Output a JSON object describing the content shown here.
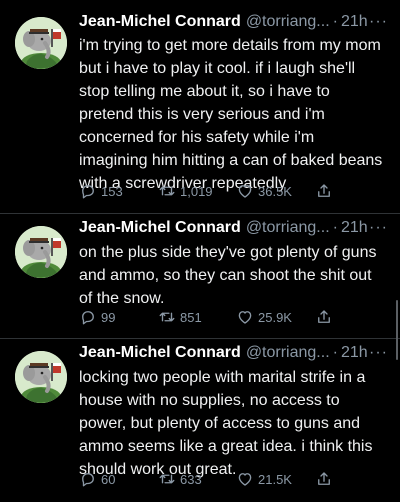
{
  "tweets": [
    {
      "name": "Jean-Michel Connard",
      "handle": "@torriang...",
      "separator": "·",
      "time": "21h",
      "more": "···",
      "text": "i'm trying to get more details from my mom\nbut i have to play it cool. if i laugh she'll\nstop telling me about it, so i have to\npretend this is very serious and i'm\nconcerned for his safety while i'm\nimagining him hitting a can of baked beans\nwith a screwdriver repeatedly",
      "replies": "153",
      "retweets": "1,019",
      "likes": "36.5K"
    },
    {
      "name": "Jean-Michel Connard",
      "handle": "@torriang...",
      "separator": "·",
      "time": "21h",
      "more": "···",
      "text": "on the plus side they've got plenty of guns\nand ammo, so they can shoot the shit out\nof the snow.",
      "replies": "99",
      "retweets": "851",
      "likes": "25.9K"
    },
    {
      "name": "Jean-Michel Connard",
      "handle": "@torriang...",
      "separator": "·",
      "time": "21h",
      "more": "···",
      "text": "locking two people with marital strife in a\nhouse with no supplies, no access to\npower, but plenty of access to guns and\nammo seems like a great idea. i think this\nshould work out great.",
      "replies": "60",
      "retweets": "633",
      "likes": "21.5K"
    }
  ],
  "icons": {
    "reply": "reply-icon",
    "retweet": "retweet-icon",
    "like": "heart-icon",
    "share": "share-icon"
  },
  "colors": {
    "background": "#000000",
    "text": "#e7e9ea",
    "muted": "#8b98a5",
    "divider": "#2f3336"
  }
}
